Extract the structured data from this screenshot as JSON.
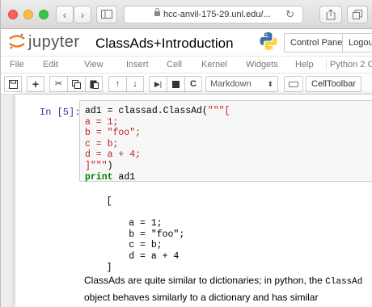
{
  "browser": {
    "url": "hcc-anvil-175-29.unl.edu/..."
  },
  "header": {
    "brand": "jupyter",
    "notebook_title": "ClassAds+Introduction",
    "control_panel": "Control Panel",
    "logout": "Logout"
  },
  "menubar": {
    "items": [
      "File",
      "Edit",
      "View",
      "Insert",
      "Cell",
      "Kernel",
      "Widgets",
      "Help"
    ],
    "kernel": "Python 2 C"
  },
  "toolbar": {
    "cell_type": "Markdown",
    "celltoolbar": "CellToolbar"
  },
  "cell": {
    "prompt": "In [5]:",
    "lines": {
      "l1_pre": "ad1 = classad.ClassAd(",
      "l1_str": "\"\"\"[",
      "l2": "a = 1;",
      "l3": "b = \"foo\";",
      "l4": "c = b;",
      "l5": "d = a + 4;",
      "l6": "]\"\"\"",
      "l6_close": ")",
      "l7_kw": "print",
      "l7_rest": " ad1"
    }
  },
  "output": {
    "text": "    [\n\n        a = 1;\n        b = \"foo\";\n        c = b;\n        d = a + 4\n    ]"
  },
  "markdown": {
    "part1": "ClassAds are quite similar to dictionaries; in python, the ",
    "code": "ClassAd",
    "part2": " object behaves similarly to a dictionary and has similar convenience methods:"
  },
  "colors": {
    "prompt": "#303f9f",
    "keyword": "#008000",
    "string": "#ba2121",
    "jupyter_orange": "#f37726"
  }
}
